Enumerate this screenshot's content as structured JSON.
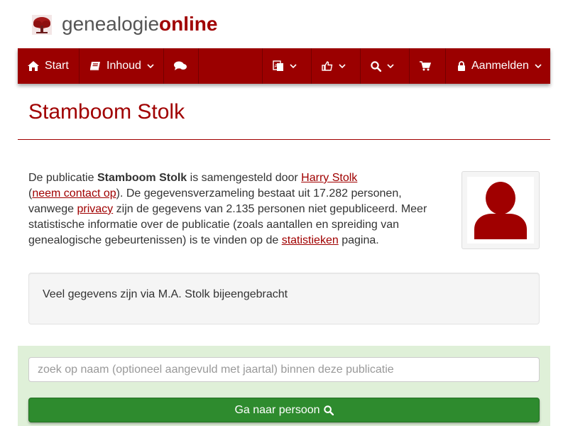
{
  "header": {
    "logo_part1": "genealogie",
    "logo_part2": "online"
  },
  "navbar": {
    "start_label": "Start",
    "inhoud_label": "Inhoud",
    "login_label": "Aanmelden",
    "icons": [
      "home-icon",
      "book-icon",
      "comments-icon",
      "language-icon",
      "thumbs-up-icon",
      "search-icon",
      "shopping-cart-icon",
      "lock-icon",
      "chevron-down-icon"
    ]
  },
  "page": {
    "title": "Stamboom Stolk"
  },
  "intro": {
    "t1": "De publicatie ",
    "pub_name": "Stamboom Stolk",
    "t2": " is samengesteld door ",
    "author_link": "Harry Stolk",
    "t3": "(",
    "contact_link": "neem contact op",
    "t4": "). De gegevensverzameling bestaat uit 17.282 personen, vanwege ",
    "privacy_link": "privacy",
    "t5": " zijn de gegevens van 2.135 personen niet gepubliceerd. Meer statistische informatie over de publicatie (zoals aantallen en spreiding van genealogische gebeurtenissen) is te vinden op de ",
    "stats_link": "statistieken",
    "t6": " pagina."
  },
  "note": {
    "text": "Veel gegevens zijn via M.A. Stolk bijeengebracht"
  },
  "search": {
    "placeholder": "zoek op naam (optioneel aangevuld met jaartal) binnen deze publicatie",
    "value": "",
    "button_label": "Ga naar persoon"
  },
  "colors": {
    "brand": "#a00000",
    "navbar": "#9b0000",
    "panel_green": "#dff0d8",
    "button_green": "#2e8b2e"
  }
}
